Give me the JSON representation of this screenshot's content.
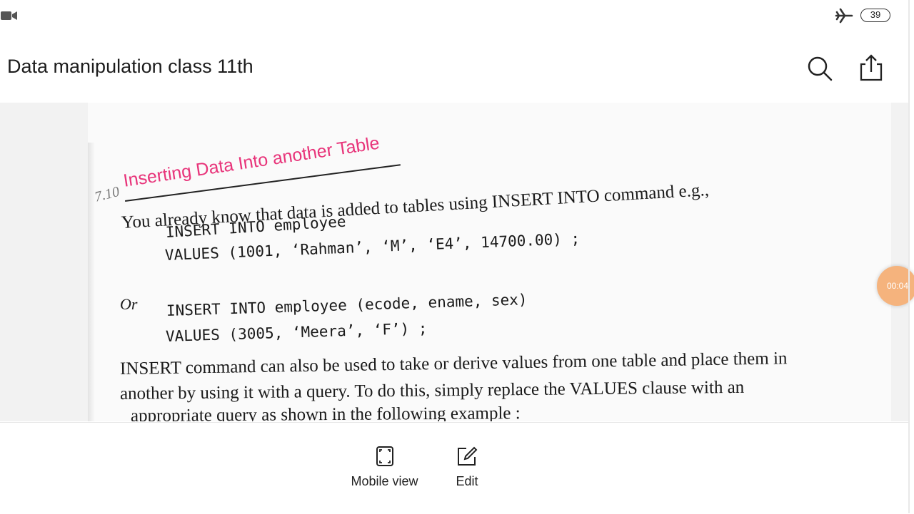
{
  "status": {
    "battery_level": "39",
    "icons": [
      "video-camera-icon",
      "airplane-mode-icon",
      "battery-icon"
    ]
  },
  "toolbar": {
    "title": "Data manipulation class 11th",
    "search_icon": "search-icon",
    "share_icon": "share-icon"
  },
  "document": {
    "section_number": "7.10",
    "heading": "Inserting Data Into another Table",
    "intro": "You already know that data is added to tables using INSERT INTO command e.g.,",
    "code1_line1": "INSERT INTO employee",
    "code1_line2": "VALUES (1001, ‘Rahman’, ‘M’, ‘E4’, 14700.00) ;",
    "or_label": "Or",
    "code2_line1": "INSERT INTO employee (ecode, ename, sex)",
    "code2_line2": "VALUES (3005, ‘Meera’, ‘F’) ;",
    "para_line1": "INSERT command can also be used to take or derive values from one table and place them in",
    "para_line2": "another by using it with a query. To do this, simply replace the VALUES clause with an",
    "para_line3": "appropriate query as shown in the following example :"
  },
  "recording": {
    "time": "00:04"
  },
  "bottom_bar": {
    "mobile_view_label": "Mobile view",
    "edit_label": "Edit"
  },
  "colors": {
    "heading": "#e8347a",
    "recording_bubble": "#f5b37d",
    "background": "#ffffff"
  }
}
